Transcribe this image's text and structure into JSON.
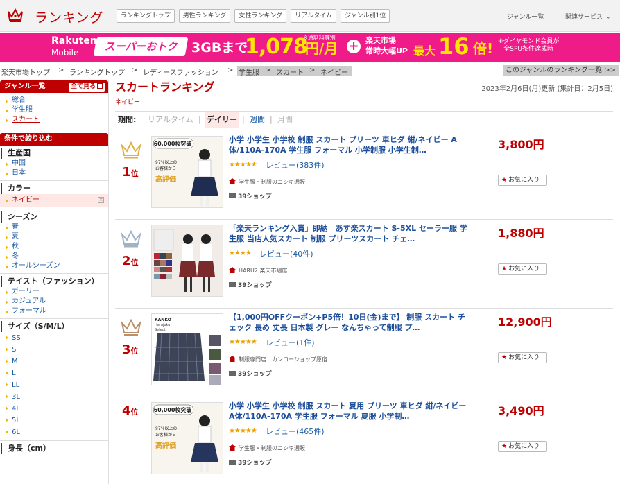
{
  "header": {
    "logo_text": "ランキング",
    "tabs": [
      "ランキングトップ",
      "男性ランキング",
      "女性ランキング",
      "リアルタイム",
      "ジャンル別1位"
    ],
    "genre_list": "ジャンル一覧",
    "related": "関連サービス"
  },
  "banner": {
    "brand": "Rakuten",
    "brand_sub": "Mobile",
    "super": "スーパーおトク",
    "plan": "3GBまで",
    "price": "1,078",
    "unit": "円/月",
    "note": "※通話料等別",
    "plus": "+",
    "market1": "楽天市場",
    "market2": "常時大幅UP",
    "max": "最大",
    "times": "16",
    "bai": "倍!",
    "dia1": "※ダイヤモンド会員が",
    "dia2": "全SPU条件達成時"
  },
  "breadcrumb": {
    "items": [
      "楽天市場トップ",
      "ランキングトップ",
      "レディースファッション",
      "学生服",
      "スカート",
      "ネイビー"
    ],
    "sep": ">",
    "right_link": "このジャンルのランキング一覧 >>"
  },
  "sidebar": {
    "genre_header": "ジャンル一覧",
    "see_all": "全て見る",
    "genre_items": [
      "総合",
      "学生服",
      "スカート"
    ],
    "filter_header": "条件で絞り込む",
    "origin_title": "生産国",
    "origin_items": [
      "中国",
      "日本"
    ],
    "color_title": "カラー",
    "color_selected": "ネイビー",
    "clear": "×",
    "season_title": "シーズン",
    "season_items": [
      "春",
      "夏",
      "秋",
      "冬",
      "オールシーズン"
    ],
    "taste_title": "テイスト（ファッション）",
    "taste_items": [
      "ガーリー",
      "カジュアル",
      "フォーマル"
    ],
    "size_title": "サイズ（S/M/L）",
    "size_items": [
      "SS",
      "S",
      "M",
      "L",
      "LL",
      "3L",
      "4L",
      "5L",
      "6L"
    ],
    "height_title": "身長（cm）"
  },
  "main": {
    "title": "スカートランキング",
    "subtitle": "ネイビー",
    "updated": "2023年2月6日(月)更新 (集計日：2月5日)",
    "period_label": "期間:",
    "periods": [
      "リアルタイム",
      "デイリー",
      "週間",
      "月間"
    ],
    "period_sep": "|"
  },
  "items": [
    {
      "rank": "1",
      "rank_suffix": "位",
      "title": "小学 小学生 小学校 制服 スカート プリーツ 車ヒダ 紺/ネイビー A体/110A-170A 学生服 フォーマル 小学制服 小学生制…",
      "price": "3,800円",
      "stars": "★★★★★",
      "review": "レビュー(383件)",
      "shop": "学生服・制服のニシキ通販",
      "ship": "39ショップ",
      "fav": "お気に入り",
      "thumb_text1": "60,000枚突破",
      "thumb_text2": "高評価",
      "thumb_text3": "97%以上の",
      "thumb_text4": "お客様から"
    },
    {
      "rank": "2",
      "rank_suffix": "位",
      "title": "「楽天ランキング入賞」即納　あす楽スカート S-5XL セーラー服 学生服 当店人気スカート 制服 プリーツスカート チェ…",
      "price": "1,880円",
      "stars": "★★★★",
      "review": "レビュー(40件)",
      "shop": "HARU2 楽天市場店",
      "ship": "39ショップ",
      "fav": "お気に入り"
    },
    {
      "rank": "3",
      "rank_suffix": "位",
      "title": "【1,000円OFFクーポン+P5倍！10日(金)まで】 制服 スカート チェック 長め 丈長 日本製 グレー なんちゃって制服 プ…",
      "price": "12,900円",
      "stars": "★★★★★",
      "review": "レビュー(1件)",
      "shop": "制服専門店　カンコーショップ原宿",
      "ship": "39ショップ",
      "fav": "お気に入り",
      "thumb_text1": "KANKO",
      "thumb_text2": "Harajuku",
      "thumb_text3": "Select"
    },
    {
      "rank": "4",
      "rank_suffix": "位",
      "title": "小学 小学生 小学校 制服 スカート 夏用 プリーツ 車ヒダ 紺/ネイビー A体/110A-170A 学生服 フォーマル 夏服 小学制…",
      "price": "3,490円",
      "stars": "★★★★★",
      "review": "レビュー(465件)",
      "shop": "学生服・制服のニシキ通販",
      "ship": "39ショップ",
      "fav": "お気に入り",
      "thumb_text1": "60,000枚突破",
      "thumb_text2": "高評価",
      "thumb_text3": "97%以上の",
      "thumb_text4": "お客様から"
    }
  ],
  "colors": {
    "accent": "#bf0000",
    "banner": "#ee1b88",
    "gold": "#f0b600",
    "link": "#1d4e9a"
  }
}
